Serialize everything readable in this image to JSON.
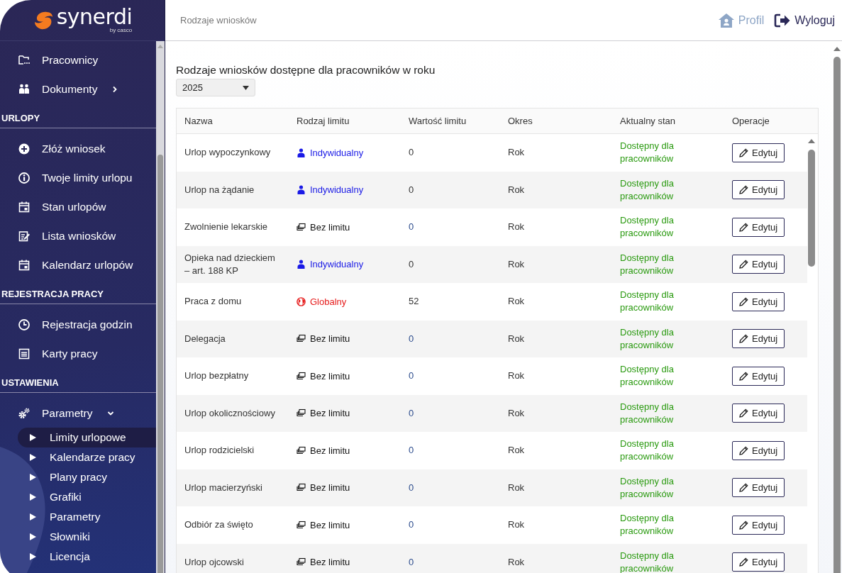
{
  "sidebar": {
    "logo": {
      "name": "synerdi",
      "tagline": "by casco"
    },
    "top_items": [
      {
        "label": "Pracownicy"
      },
      {
        "label": "Dokumenty",
        "expanded": false
      }
    ],
    "sections": [
      {
        "heading": "URLOPY",
        "items": [
          {
            "label": "Złóż wniosek"
          },
          {
            "label": "Twoje limity urlopu"
          },
          {
            "label": "Stan urlopów"
          },
          {
            "label": "Lista wniosków"
          },
          {
            "label": "Kalendarz urlopów"
          }
        ]
      },
      {
        "heading": "REJESTRACJA PRACY",
        "items": [
          {
            "label": "Rejestracja godzin"
          },
          {
            "label": "Karty pracy"
          }
        ]
      },
      {
        "heading": "USTAWIENIA",
        "items": [
          {
            "label": "Parametry",
            "expanded": true,
            "children": [
              {
                "label": "Limity urlopowe",
                "selected": true
              },
              {
                "label": "Kalendarze pracy",
                "selected": false
              },
              {
                "label": "Plany pracy",
                "selected": false
              },
              {
                "label": "Grafiki",
                "selected": false
              },
              {
                "label": "Parametry",
                "selected": false
              },
              {
                "label": "Słowniki",
                "selected": false
              },
              {
                "label": "Licencja",
                "selected": false
              }
            ]
          }
        ]
      }
    ]
  },
  "header": {
    "breadcrumb": "Rodzaje wniosków",
    "links": [
      {
        "label": "Profil",
        "disabled": true
      },
      {
        "label": "Wyloguj",
        "disabled": false
      }
    ]
  },
  "page": {
    "title": "Rodzaje wniosków dostępne dla pracowników w roku",
    "year_select": "2025"
  },
  "table": {
    "columns": [
      "Nazwa",
      "Rodzaj limitu",
      "Wartość limitu",
      "Okres",
      "Aktualny stan",
      "Operacje"
    ],
    "rows": [
      {
        "name": "Urlop wypoczynkowy",
        "limit_type": {
          "label": "Indywidualny",
          "kind": "individual"
        },
        "limit_value": "0",
        "period": "Rok",
        "status": "Dostępny dla pracowników",
        "action": "Edytuj"
      },
      {
        "name": "Urlop na żądanie",
        "limit_type": {
          "label": "Indywidualny",
          "kind": "individual"
        },
        "limit_value": "0",
        "period": "Rok",
        "status": "Dostępny dla pracowników",
        "action": "Edytuj"
      },
      {
        "name": "Zwolnienie lekarskie",
        "limit_type": {
          "label": "Bez limitu",
          "kind": "none"
        },
        "limit_value": "0",
        "period": "Rok",
        "status": "Dostępny dla pracowników",
        "action": "Edytuj"
      },
      {
        "name": "Opieka nad dzieckiem – art. 188 KP",
        "limit_type": {
          "label": "Indywidualny",
          "kind": "individual"
        },
        "limit_value": "0",
        "period": "Rok",
        "status": "Dostępny dla pracowników",
        "action": "Edytuj"
      },
      {
        "name": "Praca z domu",
        "limit_type": {
          "label": "Globalny",
          "kind": "global"
        },
        "limit_value": "52",
        "period": "Rok",
        "status": "Dostępny dla pracowników",
        "action": "Edytuj"
      },
      {
        "name": "Delegacja",
        "limit_type": {
          "label": "Bez limitu",
          "kind": "none"
        },
        "limit_value": "0",
        "period": "Rok",
        "status": "Dostępny dla pracowników",
        "action": "Edytuj"
      },
      {
        "name": "Urlop bezpłatny",
        "limit_type": {
          "label": "Bez limitu",
          "kind": "none"
        },
        "limit_value": "0",
        "period": "Rok",
        "status": "Dostępny dla pracowników",
        "action": "Edytuj"
      },
      {
        "name": "Urlop okolicznościowy",
        "limit_type": {
          "label": "Bez limitu",
          "kind": "none"
        },
        "limit_value": "0",
        "period": "Rok",
        "status": "Dostępny dla pracowników",
        "action": "Edytuj"
      },
      {
        "name": "Urlop rodzicielski",
        "limit_type": {
          "label": "Bez limitu",
          "kind": "none"
        },
        "limit_value": "0",
        "period": "Rok",
        "status": "Dostępny dla pracowników",
        "action": "Edytuj"
      },
      {
        "name": "Urlop macierzyński",
        "limit_type": {
          "label": "Bez limitu",
          "kind": "none"
        },
        "limit_value": "0",
        "period": "Rok",
        "status": "Dostępny dla pracowników",
        "action": "Edytuj"
      },
      {
        "name": "Odbiór za święto",
        "limit_type": {
          "label": "Bez limitu",
          "kind": "none"
        },
        "limit_value": "0",
        "period": "Rok",
        "status": "Dostępny dla pracowników",
        "action": "Edytuj"
      },
      {
        "name": "Urlop ojcowski",
        "limit_type": {
          "label": "Bez limitu",
          "kind": "none"
        },
        "limit_value": "0",
        "period": "Rok",
        "status": "Dostępny dla pracowników",
        "action": "Edytuj"
      }
    ]
  }
}
